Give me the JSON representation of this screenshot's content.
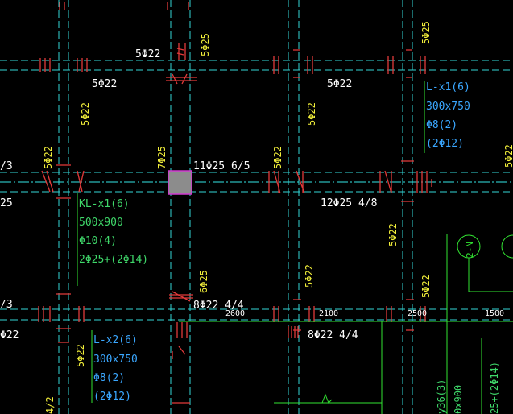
{
  "colors": {
    "background": "#000000",
    "beam_line": "#33d6d6",
    "beam_dash": "#33e6e6",
    "rebar_red": "#e23a3a",
    "white_text": "#ffffff",
    "yellow_text": "#f2ef3a",
    "green_text": "#3fd86a",
    "blue_text": "#3aa7ff",
    "column_fill": "#8c8c8c",
    "column_border": "#d23ad2",
    "axis_green": "#32e432"
  },
  "labels": {
    "top_5d22_a": "5Φ22",
    "top_5d22_b": "5Φ22",
    "top_5d22_c": "5Φ22",
    "v_5d25_top_center": "5Φ25",
    "v_5d25_top_right": "5Φ25",
    "v_5d22_upper_left": "5Φ22",
    "v_5d22_upper_mid": "5Φ22",
    "v_5d22_left_mid": "5Φ22",
    "v_7d25": "7Φ25",
    "v_5d22_center_row": "5Φ22",
    "v_5d22_right_low": "5Φ22",
    "v_5d22_mid_low": "5Φ22",
    "v_5d22_right_lower": "5Φ22",
    "v_6d25": "6Φ25",
    "v_5d22_bottom_left": "5Φ22",
    "v_edge_right": "5Φ22",
    "edge_left_upper": "/3",
    "edge_left_mid": "25",
    "edge_left_low": "/3",
    "edge_left_bottom": "Φ22",
    "edge_left_4_2": "4/2",
    "top_11d25": "11Φ25 6/5",
    "mid_12d25": "12Φ25 4/8",
    "low_8d22_a": "8Φ22 4/4",
    "low_8d22_b": "8Φ22 4/4",
    "dim_2600": "2600",
    "dim_2100": "2100",
    "dim_2500": "2500",
    "dim_1500": "1500",
    "axis_tag": "2-N",
    "bottom_right_a": "y36(3)",
    "bottom_right_b": "0x900",
    "bottom_right_c": "25+(2Φ14)"
  },
  "beam_kl": {
    "name": "KL-x1(6)",
    "size": "500x900",
    "stirrup": "Φ10(4)",
    "bars": "2Φ25+(2Φ14)"
  },
  "beam_l1": {
    "name": "L-x1(6)",
    "size": "300x750",
    "stirrup": "Φ8(2)",
    "bars": "(2Φ12)"
  },
  "beam_l2": {
    "name": "L-x2(6)",
    "size": "300x750",
    "stirrup": "Φ8(2)",
    "bars": "(2Φ12)"
  }
}
